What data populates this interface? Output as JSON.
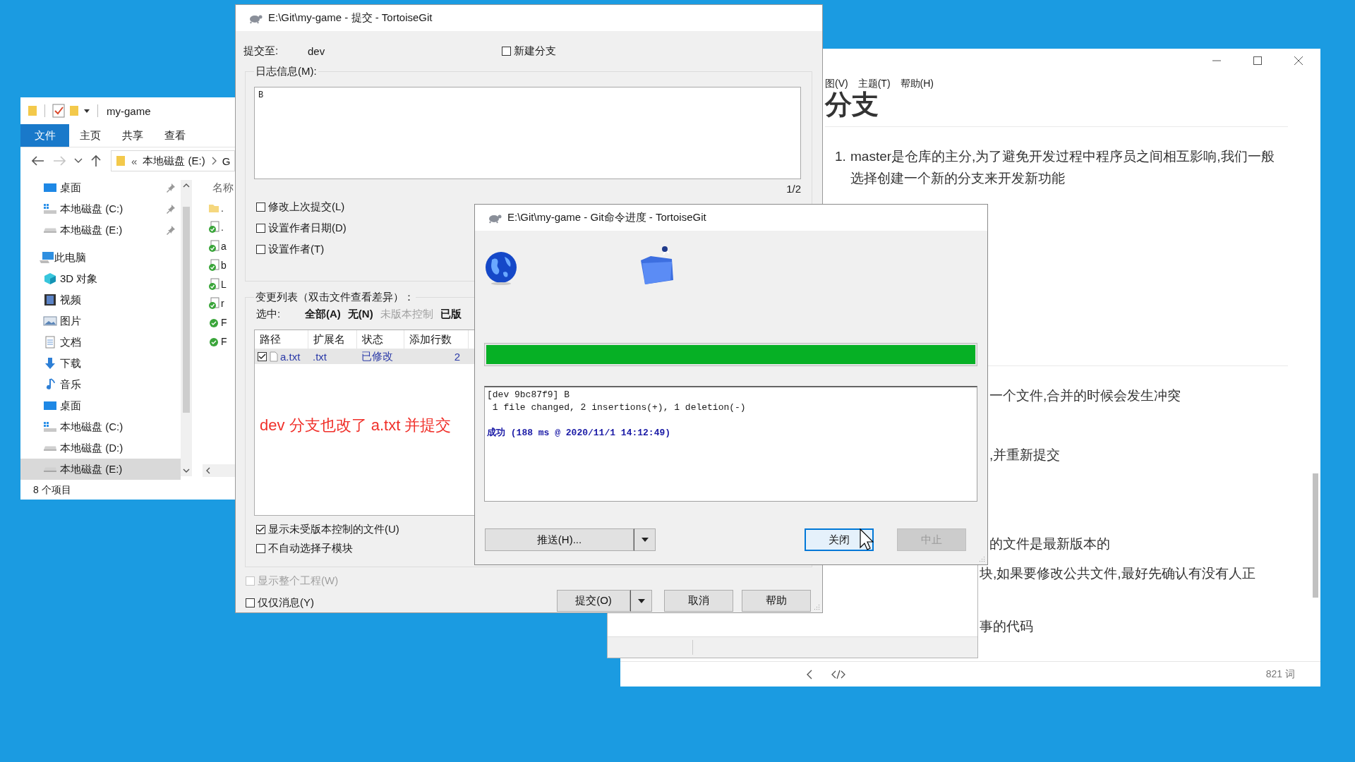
{
  "explorer": {
    "title": "my-game",
    "ribbon_tabs": [
      {
        "label": "文件",
        "selected": true
      },
      {
        "label": "主页",
        "selected": false
      },
      {
        "label": "共享",
        "selected": false
      },
      {
        "label": "查看",
        "selected": false
      }
    ],
    "address": {
      "overflow": "«",
      "segments": [
        "本地磁盘 (E:)",
        "G"
      ]
    },
    "quick_access": [
      {
        "label": "桌面",
        "kind": "desktop",
        "pinned": true,
        "selected": false
      },
      {
        "label": "本地磁盘 (C:)",
        "kind": "system-drive",
        "pinned": true,
        "selected": false
      },
      {
        "label": "本地磁盘 (E:)",
        "kind": "drive",
        "pinned": true,
        "selected": false
      }
    ],
    "this_pc": {
      "label": "此电脑",
      "children": [
        {
          "label": "3D 对象",
          "kind": "cube",
          "selected": false
        },
        {
          "label": "视频",
          "kind": "video",
          "selected": false
        },
        {
          "label": "图片",
          "kind": "pictures",
          "selected": false
        },
        {
          "label": "文档",
          "kind": "documents",
          "selected": false
        },
        {
          "label": "下载",
          "kind": "downloads",
          "selected": false
        },
        {
          "label": "音乐",
          "kind": "music",
          "selected": false
        },
        {
          "label": "桌面",
          "kind": "desktop",
          "selected": false
        },
        {
          "label": "本地磁盘 (C:)",
          "kind": "system-drive",
          "selected": false
        },
        {
          "label": "本地磁盘 (D:)",
          "kind": "drive",
          "selected": false
        },
        {
          "label": "本地磁盘 (E:)",
          "kind": "drive",
          "selected": true
        }
      ]
    },
    "column_header": "名称",
    "files": [
      {
        "name": ".",
        "kind": "folder"
      },
      {
        "name": ".",
        "kind": "tracked"
      },
      {
        "name": "a",
        "kind": "tracked"
      },
      {
        "name": "b",
        "kind": "tracked"
      },
      {
        "name": "L",
        "kind": "tracked"
      },
      {
        "name": "r",
        "kind": "tracked"
      },
      {
        "name": "F",
        "kind": "added"
      },
      {
        "name": "F",
        "kind": "added"
      }
    ],
    "status": "8 个项目"
  },
  "editor": {
    "menu": [
      "图(V)",
      "主题(T)",
      "帮助(H)"
    ],
    "heading": "分支",
    "list_item": {
      "marker": "1.",
      "text": "master是仓库的主分,为了避免开发过程中程序员之间相互影响,我们一般选择创建一个新的分支来开发新功能"
    },
    "fragments": [
      "一个文件,合并的时候会发生冲突",
      ",并重新提交",
      "的文件是最新版本的",
      "块,如果要修改公共文件,最好先确认有没有人正",
      "事的代码"
    ],
    "word_count": "821 词"
  },
  "commit_dialog": {
    "title": "E:\\Git\\my-game - 提交 - TortoiseGit",
    "commit_to_label": "提交至:",
    "branch": "dev",
    "new_branch": {
      "label": "新建分支",
      "checked": false
    },
    "message_group": "日志信息(M):",
    "message": "B",
    "counter": "1/2",
    "options": [
      {
        "label": "修改上次提交(L)",
        "checked": false
      },
      {
        "label": "设置作者日期(D)",
        "checked": false
      },
      {
        "label": "设置作者(T)",
        "checked": false
      }
    ],
    "changes_group": "变更列表（双击文件查看差异）：",
    "select_label": "选中:",
    "select_links": [
      {
        "label": "全部(A)",
        "disabled": false
      },
      {
        "label": "无(N)",
        "disabled": false
      },
      {
        "label": "未版本控制",
        "disabled": true
      },
      {
        "label": "已版",
        "disabled": false
      }
    ],
    "columns": [
      "路径",
      "扩展名",
      "状态",
      "添加行数"
    ],
    "files": [
      {
        "checked": true,
        "path": "a.txt",
        "ext": ".txt",
        "status": "已修改",
        "added": "2"
      }
    ],
    "annotation": "dev 分支也改了 a.txt 并提交",
    "list_options": [
      {
        "label": "显示未受版本控制的文件(U)",
        "checked": true,
        "disabled": false
      },
      {
        "label": "不自动选择子模块",
        "checked": false,
        "disabled": false
      }
    ],
    "bottom_options": [
      {
        "label": "显示整个工程(W)",
        "checked": false,
        "disabled": true
      },
      {
        "label": "仅仅消息(Y)",
        "checked": false,
        "disabled": false
      }
    ],
    "buttons": [
      {
        "label": "提交(O)",
        "kind": "split"
      },
      {
        "label": "取消",
        "kind": "plain"
      },
      {
        "label": "帮助",
        "kind": "plain"
      }
    ]
  },
  "progress_dialog": {
    "title": "E:\\Git\\my-game - Git命令进度 - TortoiseGit",
    "progress": {
      "level": 1
    },
    "log": [
      {
        "text": "[dev 9bc87f9] B",
        "kind": "output"
      },
      {
        "text": " 1 file changed, 2 insertions(+), 1 deletion(-)",
        "kind": "output"
      },
      {
        "text": "成功 (188 ms @ 2020/11/1 14:12:49)",
        "kind": "success"
      }
    ],
    "buttons": [
      {
        "label": "推送(H)...",
        "kind": "split",
        "disabled": false
      },
      {
        "label": "关闭",
        "kind": "default",
        "disabled": false
      },
      {
        "label": "中止",
        "kind": "plain",
        "disabled": true
      }
    ]
  }
}
